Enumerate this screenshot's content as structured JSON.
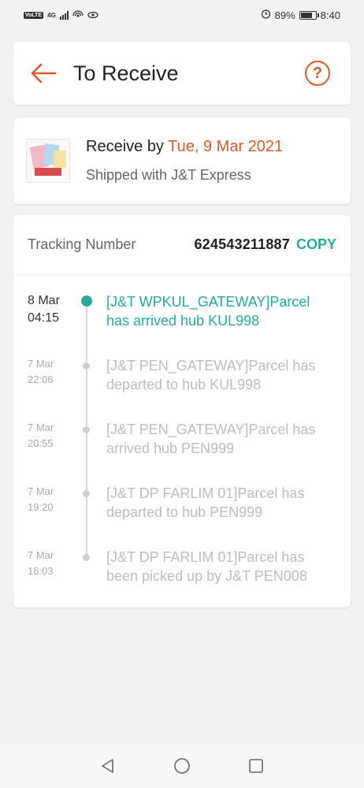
{
  "status_bar": {
    "network_badge": "VoLTE",
    "network_type": "4G",
    "battery": "89%",
    "time": "8:40"
  },
  "header": {
    "title": "To Receive",
    "back_icon": "arrow-left-icon",
    "help_icon": "question-circle-icon",
    "help_glyph": "?",
    "accent_color": "#e0572c"
  },
  "delivery": {
    "receive_prefix": "Receive by ",
    "receive_date": "Tue, 9 Mar 2021",
    "shipped_with": "Shipped with J&T Express"
  },
  "tracking": {
    "label": "Tracking Number",
    "number": "624543211887",
    "copy_label": "COPY",
    "accent_color": "#26aa99",
    "events": [
      {
        "date": "8 Mar",
        "time": "04:15",
        "text": "[J&T WPKUL_GATEWAY]Parcel has arrived hub KUL998",
        "active": true
      },
      {
        "date": "7 Mar",
        "time": "22:06",
        "text": "[J&T PEN_GATEWAY]Parcel has departed to hub KUL998",
        "active": false
      },
      {
        "date": "7 Mar",
        "time": "20:55",
        "text": "[J&T PEN_GATEWAY]Parcel has arrived hub PEN999",
        "active": false
      },
      {
        "date": "7 Mar",
        "time": "19:20",
        "text": "[J&T DP FARLIM 01]Parcel has departed to hub PEN999",
        "active": false
      },
      {
        "date": "7 Mar",
        "time": "16:03",
        "text": "[J&T DP FARLIM 01]Parcel has been picked up by J&T PEN008",
        "active": false
      }
    ]
  },
  "nav": {
    "back_icon": "triangle-back-icon",
    "home_icon": "circle-home-icon",
    "recents_icon": "square-recents-icon"
  }
}
